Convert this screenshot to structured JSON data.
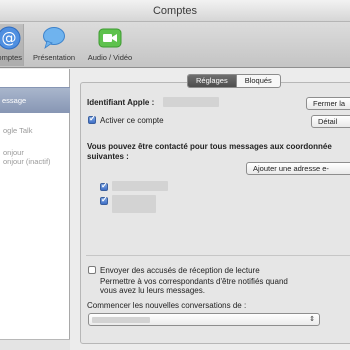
{
  "window": {
    "title": "Comptes"
  },
  "toolbar": {
    "items": [
      {
        "label": "Comptes"
      },
      {
        "label": "Présentation"
      },
      {
        "label": "Audio / Vidéo"
      }
    ]
  },
  "sidebar": {
    "selected_label": "essage",
    "items": [
      {
        "label": "ogle Talk"
      },
      {
        "label": "onjour"
      },
      {
        "label": "onjour (inactif)"
      }
    ]
  },
  "settings": {
    "tabs": [
      {
        "label": "Réglages"
      },
      {
        "label": "Bloqués"
      }
    ],
    "apple_id_label": "Identifiant Apple :",
    "close_button": "Fermer la",
    "enable_checkbox": "Activer ce compte",
    "details_button": "Détail",
    "contact_text_line1": "Vous pouvez être contacté pour tous messages aux coordonnée",
    "contact_text_line2": "suivantes :",
    "add_address_button": "Ajouter une adresse e-",
    "read_receipts_label": "Envoyer des accusés de réception de lecture",
    "read_receipts_desc_line1": "Permettre à vos correspondants d'être notifiés quand",
    "read_receipts_desc_line2": "vous avez lu leurs messages.",
    "start_conversations_label": "Commencer les nouvelles conversations de :",
    "popup_arrows": "⇕"
  },
  "colors": {
    "accent": "#3f70c8",
    "selection": "#8796b4"
  }
}
